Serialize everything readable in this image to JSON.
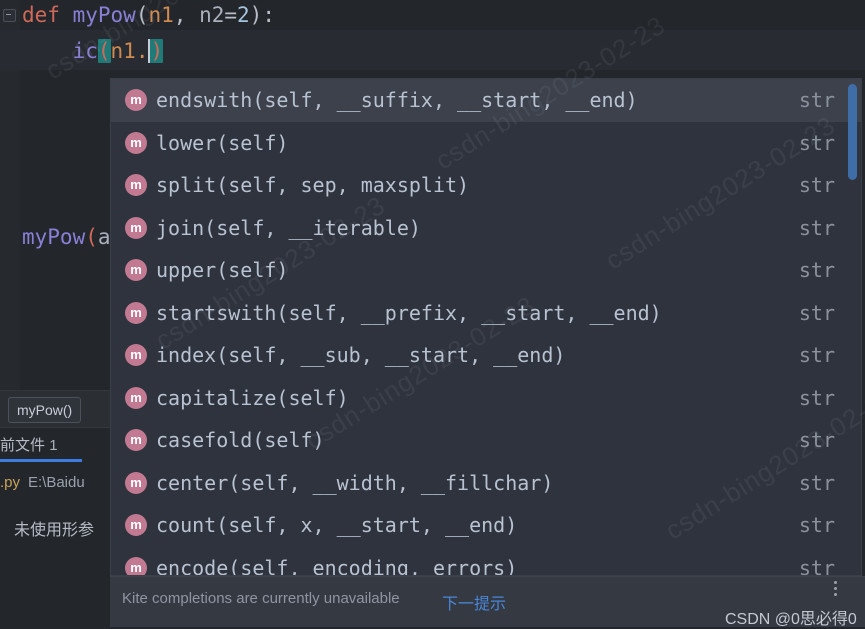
{
  "editor": {
    "line1": {
      "keyword": "def",
      "space": " ",
      "name": "myPow",
      "open": "(",
      "arg1": "n1",
      "comma": ", ",
      "arg2": "n2",
      "eq": "=",
      "num": "2",
      "close": ")",
      "colon": ":"
    },
    "line2": {
      "indent": "    ",
      "prefix": "ic",
      "open_paren": "(",
      "arg": "n1",
      "dot": ".",
      "close_paren": ")"
    },
    "line3": {
      "name": "myPow",
      "open": "(",
      "arg": "a"
    }
  },
  "breadcrumb": {
    "label": "myPow()"
  },
  "inspection_panel": {
    "tab_label": "前文件",
    "tab_count": "1",
    "file_ext": ".py",
    "file_path": "E:\\Baidu",
    "warning": "未使用形参"
  },
  "completion_popup": {
    "items": [
      {
        "icon": "m",
        "signature": "endswith(self, __suffix, __start, __end)",
        "return_type": "str",
        "selected": true
      },
      {
        "icon": "m",
        "signature": "lower(self)",
        "return_type": "str",
        "selected": false
      },
      {
        "icon": "m",
        "signature": "split(self, sep, maxsplit)",
        "return_type": "str",
        "selected": false
      },
      {
        "icon": "m",
        "signature": "join(self, __iterable)",
        "return_type": "str",
        "selected": false
      },
      {
        "icon": "m",
        "signature": "upper(self)",
        "return_type": "str",
        "selected": false
      },
      {
        "icon": "m",
        "signature": "startswith(self, __prefix, __start, __end)",
        "return_type": "str",
        "selected": false
      },
      {
        "icon": "m",
        "signature": "index(self, __sub, __start, __end)",
        "return_type": "str",
        "selected": false
      },
      {
        "icon": "m",
        "signature": "capitalize(self)",
        "return_type": "str",
        "selected": false
      },
      {
        "icon": "m",
        "signature": "casefold(self)",
        "return_type": "str",
        "selected": false
      },
      {
        "icon": "m",
        "signature": "center(self, __width, __fillchar)",
        "return_type": "str",
        "selected": false
      },
      {
        "icon": "m",
        "signature": "count(self, x, __start, __end)",
        "return_type": "str",
        "selected": false
      },
      {
        "icon": "m",
        "signature": "encode(self, encoding, errors)",
        "return_type": "str",
        "selected": false
      }
    ]
  },
  "status_bar": {
    "kite_message": "Kite completions are currently unavailable",
    "kite_link": "下一提示",
    "menu_icon": "more-vertical-icon",
    "watermark": "CSDN @0思必得0"
  },
  "watermarks": [
    "csdn-bing2023-02-23",
    "csdn-bing2023-02-23",
    "csdn-bing2023-02-23",
    "csdn-bing2023-02-23",
    "csdn-bing2023-02-23",
    "csdn-bing2023-02-23"
  ],
  "colors": {
    "editor_background": "#23262b",
    "popup_background": "#2f333d",
    "popup_selected": "#3c414c",
    "accent_blue": "#3d7de0",
    "scrollbar_blue": "#3f6da8",
    "method_icon": "#c17a92",
    "bracket_highlight": "#1f7a78",
    "keyword": "#cf6a5a",
    "function_name": "#8a7fd6",
    "parameter": "#cf8a4f"
  }
}
